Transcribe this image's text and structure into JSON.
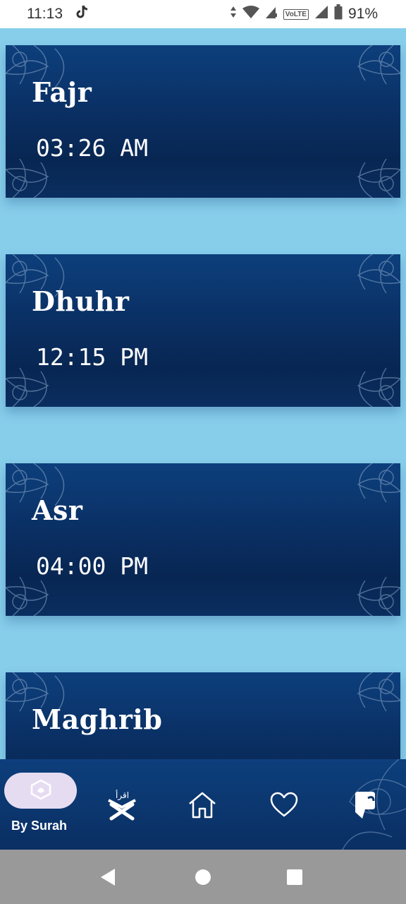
{
  "status_bar": {
    "time": "11:13",
    "battery": "91%",
    "network": "VoLTE",
    "icons": [
      "tiktok-icon",
      "data-arrows-icon",
      "wifi-icon",
      "signal-icon",
      "battery-icon"
    ]
  },
  "prayers": [
    {
      "name": "Fajr",
      "time": "03:26 AM"
    },
    {
      "name": "Dhuhr",
      "time": "12:15 PM"
    },
    {
      "name": "Asr",
      "time": "04:00 PM"
    },
    {
      "name": "Maghrib",
      "time": ""
    }
  ],
  "bottom_nav": {
    "active_label": "By Surah",
    "items": [
      "by-surah-icon",
      "quran-stand-icon",
      "home-icon",
      "heart-icon",
      "bookmark-icon"
    ],
    "quran_stand_text": "اقرأ"
  },
  "colors": {
    "background": "#87CEEB",
    "card": "#0a2f63",
    "active_pill": "#e6dcf2",
    "system_nav": "#999999"
  }
}
